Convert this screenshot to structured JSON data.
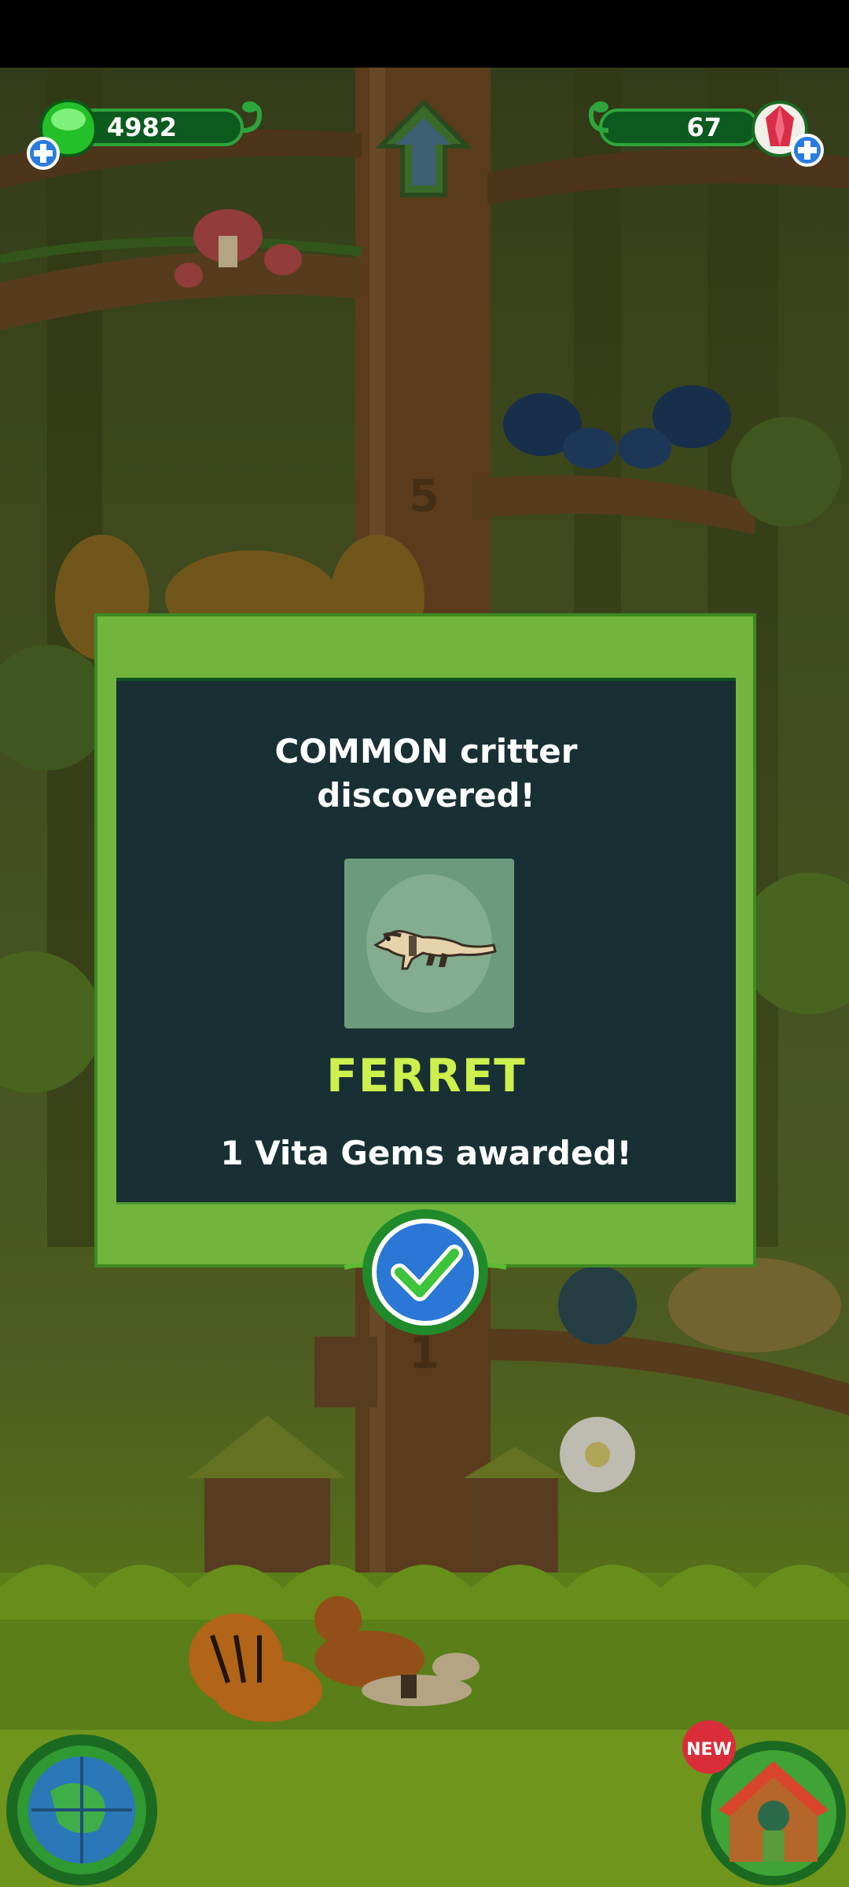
{
  "hud": {
    "energy_value": "4982",
    "gems_value": "67"
  },
  "dialog": {
    "title_line1": "COMMON critter",
    "title_line2": "discovered!",
    "critter_name": "FERRET",
    "reward_text": "1 Vita Gems awarded!"
  },
  "badges": {
    "new_label": "NEW"
  },
  "colors": {
    "accent_green": "#72b53d",
    "panel_dark": "#183033",
    "name_yellow_green": "#cdf04e",
    "confirm_blue": "#2a77d6"
  },
  "icons": {
    "energy": "green-gem-icon",
    "gems": "red-crystal-icon",
    "confirm": "checkmark-icon",
    "world": "globe-icon",
    "house": "house-icon"
  }
}
